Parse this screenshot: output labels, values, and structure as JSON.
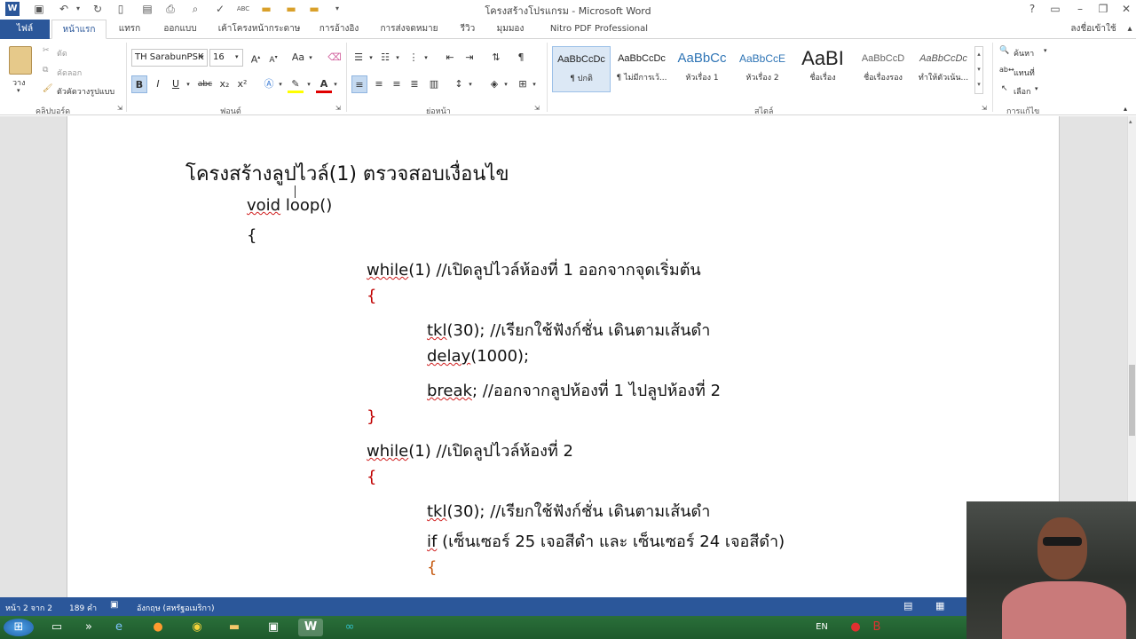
{
  "window": {
    "title": "โครงสร้างโปรแกรม - Microsoft Word",
    "help": "?",
    "minimize": "–",
    "restore": "❐",
    "close": "✕"
  },
  "qat_icons": [
    "word-app-icon",
    "save-icon",
    "undo-icon",
    "redo-icon",
    "new-doc-icon",
    "open-icon",
    "print-icon",
    "print-preview-icon",
    "spelling-icon",
    "abc-icon",
    "folder-icon",
    "folder-icon",
    "folder-icon"
  ],
  "tabs": {
    "file": "ไฟล์",
    "home": "หน้าแรก",
    "insert": "แทรก",
    "design": "ออกแบบ",
    "layout": "เค้าโครงหน้ากระดาษ",
    "references": "การอ้างอิง",
    "mailings": "การส่งจดหมาย",
    "review": "รีวิว",
    "view": "มุมมอง",
    "nitro": "Nitro PDF Professional",
    "signin": "ลงชื่อเข้าใช้"
  },
  "ribbon": {
    "clipboard": {
      "paste": "วาง",
      "cut": "ตัด",
      "copy": "คัดลอก",
      "format_painter": "ตัวคัดวางรูปแบบ",
      "label": "คลิปบอร์ด"
    },
    "font": {
      "font_name": "TH SarabunPSK",
      "font_size": "16",
      "bold": "B",
      "italic": "I",
      "underline": "U",
      "strike": "abc",
      "subscript": "x₂",
      "superscript": "x²",
      "change_case": "Aa",
      "label": "ฟอนต์"
    },
    "paragraph": {
      "label": "ย่อหน้า",
      "pilcrow": "¶"
    },
    "styles": {
      "items": [
        {
          "sample": "AaBbCcDc",
          "name": "¶ ปกติ"
        },
        {
          "sample": "AaBbCcDc",
          "name": "¶ ไม่มีการเว้..."
        },
        {
          "sample": "AaBbCc",
          "name": "หัวเรื่อง 1"
        },
        {
          "sample": "AaBbCcE",
          "name": "หัวเรื่อง 2"
        },
        {
          "sample": "AaBI",
          "name": "ชื่อเรื่อง"
        },
        {
          "sample": "AaBbCcD",
          "name": "ชื่อเรื่องรอง"
        },
        {
          "sample": "AaBbCcDc",
          "name": "ทำให้ตัวเน้น..."
        }
      ],
      "label": "สไตล์"
    },
    "editing": {
      "find": "ค้นหา",
      "replace": "แทนที่",
      "select": "เลือก",
      "label": "การแก้ไข"
    }
  },
  "document": {
    "heading": "โครงสร้างลูปไวล์(1) ตรวจสอบเงื่อนไข",
    "lines": [
      {
        "kw": "void",
        "rest": " loop()"
      },
      {
        "text": "{"
      },
      {
        "kw": "while",
        "rest": "(1) //เปิดลูปไวล์ห้องที่ 1 ออกจากจุดเริ่มต้น"
      },
      {
        "text": "{"
      },
      {
        "kw": "tkl",
        "rest": "(30); //เรียกใช้ฟังก์ชั่น เดินตามเส้นดำ"
      },
      {
        "kw": "delay",
        "rest": "(1000);"
      },
      {
        "kw": "break",
        "rest": ";  //ออกจากลูปห้องที่ 1 ไปลูปห้องที่ 2"
      },
      {
        "text": "}"
      },
      {
        "kw": "while",
        "rest": "(1) //เปิดลูปไวล์ห้องที่ 2"
      },
      {
        "text": "{"
      },
      {
        "kw": "tkl",
        "rest": "(30); //เรียกใช้ฟังก์ชั่น เดินตามเส้นดำ"
      },
      {
        "kw": "if",
        "rest": " (เซ็นเซอร์ 25 เจอสีดำ และ เซ็นเซอร์ 24 เจอสีดำ)"
      },
      {
        "text": "{"
      }
    ]
  },
  "status": {
    "page": "หน้า 2 จาก 2",
    "words": "189 คำ",
    "language": "อังกฤษ (สหรัฐอเมริกา)"
  },
  "taskbar": {
    "lang": "EN",
    "apps": [
      "start-orb-icon",
      "file-explorer-icon",
      "chevron-icon",
      "ie-icon",
      "firefox-icon",
      "chrome-icon",
      "folder-icon",
      "app-icon",
      "word-icon",
      "arduino-icon"
    ]
  },
  "colors": {
    "word_blue": "#2b579a",
    "brace_red": "#c00000",
    "brace_orange": "#c55a11"
  }
}
